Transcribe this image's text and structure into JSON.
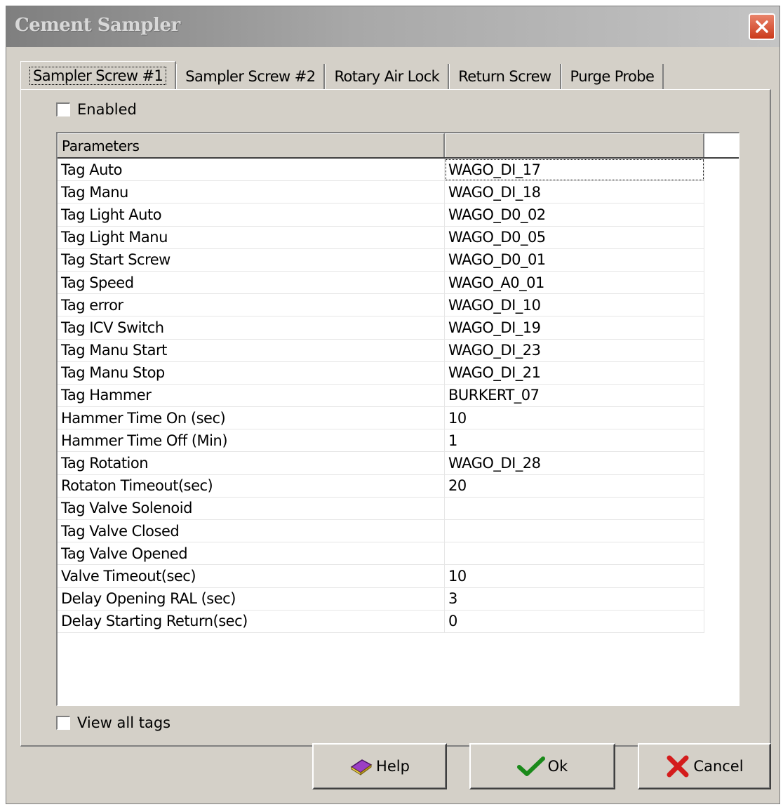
{
  "window": {
    "title": "Cement Sampler"
  },
  "tabs": [
    {
      "label": "Sampler Screw #1",
      "active": true
    },
    {
      "label": "Sampler Screw #2",
      "active": false
    },
    {
      "label": "Rotary Air Lock",
      "active": false
    },
    {
      "label": "Return Screw",
      "active": false
    },
    {
      "label": "Purge Probe",
      "active": false
    }
  ],
  "enabled": {
    "label": "Enabled",
    "checked": false
  },
  "grid": {
    "header": {
      "parameters": "Parameters",
      "value": ""
    },
    "rows": [
      {
        "param": "Tag Auto",
        "value": "WAGO_DI_17"
      },
      {
        "param": "Tag Manu",
        "value": "WAGO_DI_18"
      },
      {
        "param": "Tag Light Auto",
        "value": "WAGO_D0_02"
      },
      {
        "param": "Tag Light Manu",
        "value": "WAGO_D0_05"
      },
      {
        "param": "Tag Start Screw",
        "value": "WAGO_D0_01"
      },
      {
        "param": "Tag Speed",
        "value": "WAGO_A0_01"
      },
      {
        "param": "Tag error",
        "value": "WAGO_DI_10"
      },
      {
        "param": "Tag ICV Switch",
        "value": "WAGO_DI_19"
      },
      {
        "param": "Tag Manu Start",
        "value": "WAGO_DI_23"
      },
      {
        "param": "Tag Manu Stop",
        "value": "WAGO_DI_21"
      },
      {
        "param": "Tag Hammer",
        "value": "BURKERT_07"
      },
      {
        "param": "Hammer Time On (sec)",
        "value": "10"
      },
      {
        "param": "Hammer Time Off (Min)",
        "value": "1"
      },
      {
        "param": "Tag Rotation",
        "value": "WAGO_DI_28"
      },
      {
        "param": "Rotaton Timeout(sec)",
        "value": "20"
      },
      {
        "param": "Tag Valve Solenoid",
        "value": ""
      },
      {
        "param": "Tag Valve Closed",
        "value": ""
      },
      {
        "param": "Tag Valve Opened",
        "value": ""
      },
      {
        "param": "Valve Timeout(sec)",
        "value": "10"
      },
      {
        "param": "Delay Opening RAL (sec)",
        "value": "3"
      },
      {
        "param": "Delay Starting Return(sec)",
        "value": "0"
      }
    ]
  },
  "view_all_tags": {
    "label": "View all tags",
    "checked": false
  },
  "buttons": {
    "help": "Help",
    "ok": "Ok",
    "cancel": "Cancel"
  },
  "icons": {
    "close": "close-icon",
    "help": "help-book-icon",
    "ok": "checkmark-icon",
    "cancel": "red-x-icon"
  }
}
